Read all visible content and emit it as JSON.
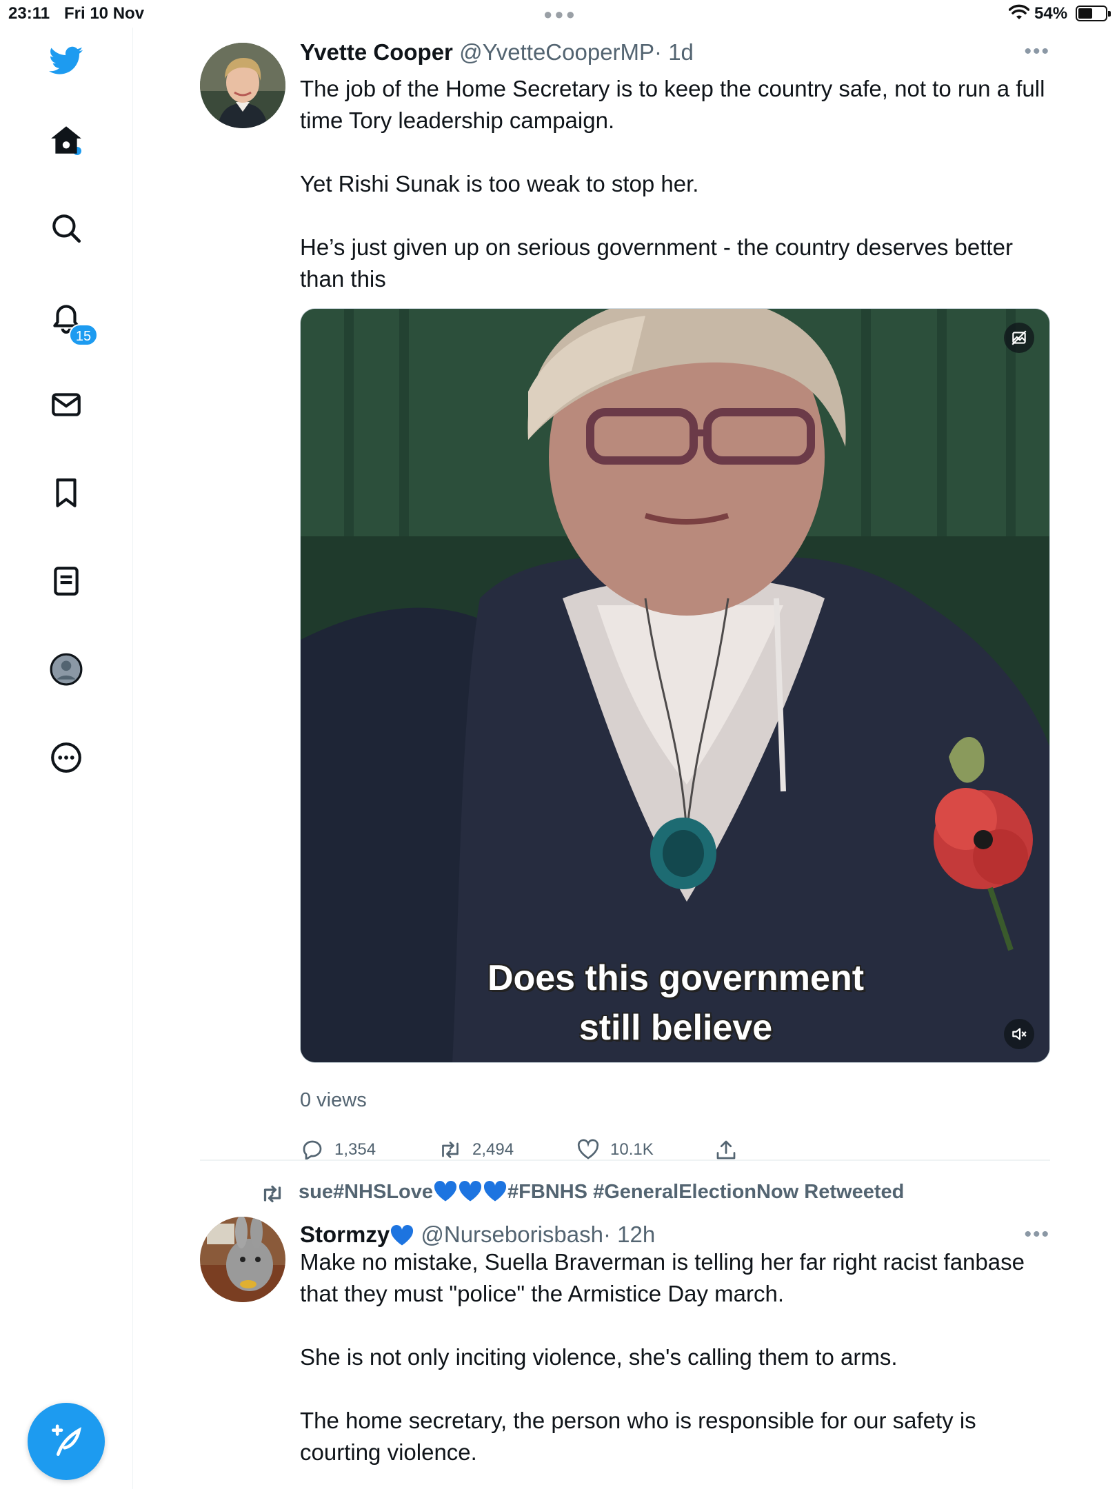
{
  "status_bar": {
    "time": "23:11",
    "date": "Fri 10 Nov",
    "battery": "54%"
  },
  "sidebar": {
    "notifications_badge": "15",
    "items": [
      "home-icon",
      "search-icon",
      "bell-icon",
      "mail-icon",
      "bookmark-icon",
      "list-icon",
      "profile-icon",
      "more-icon"
    ]
  },
  "tweet1": {
    "name": "Yvette Cooper",
    "handle": "@YvetteCooperMP",
    "time": "· 1d",
    "text": "The job of the Home Secretary is to keep the country safe, not to run a full time Tory leadership campaign.\n\nYet Rishi Sunak is too weak to stop her.\n\nHe’s just given up on serious government - the country deserves better than this",
    "video_caption_line1": "Does this government",
    "video_caption_line2": "still believe",
    "views": "0 views",
    "replies": "1,354",
    "retweets": "2,494",
    "likes": "10.1K"
  },
  "retweet_banner": {
    "prefix": "sue#NHSLove",
    "suffix": "#FBNHS #GeneralElectionNow Retweeted"
  },
  "tweet2": {
    "name": "Stormzy",
    "handle": "@Nurseborisbash",
    "time": "· 12h",
    "text": "Make no mistake, Suella Braverman is telling her far right racist fanbase that they must \"police\" the Armistice Day march.\n\nShe is not only inciting violence, she's calling them to arms.\n\nThe home secretary, the person who is responsible for our safety is courting violence."
  },
  "colors": {
    "accent": "#1d9bf0",
    "text": "#0f1419",
    "muted": "#536471"
  }
}
